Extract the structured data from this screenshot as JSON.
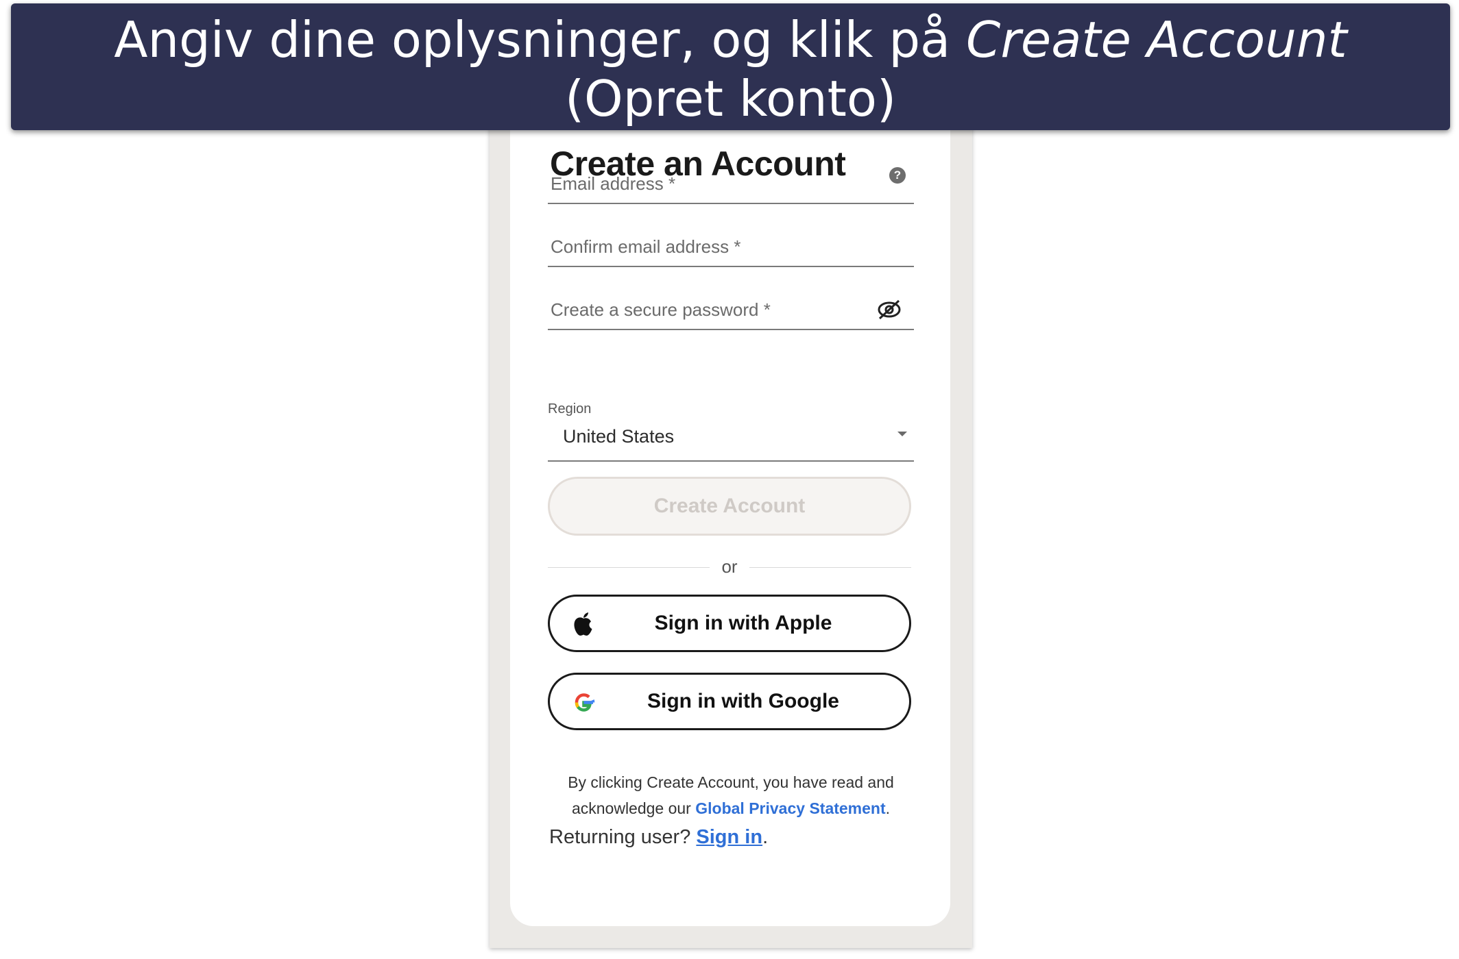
{
  "caption": {
    "part1": "Angiv dine oplysninger, og klik på ",
    "emphasis": "Create Account",
    "part2": " (Opret konto)"
  },
  "form": {
    "title": "Create an Account",
    "email_placeholder": "Email address *",
    "confirm_email_placeholder": "Confirm email address *",
    "password_placeholder": "Create a secure password *",
    "region_label": "Region",
    "region_value": "United States",
    "create_button": "Create Account",
    "divider_text": "or",
    "apple_button": "Sign in with Apple",
    "google_button": "Sign in with Google",
    "legal_text": "By clicking Create Account, you have read and acknowledge our ",
    "privacy_link": "Global Privacy Statement",
    "legal_end": ".",
    "returning_text": "Returning user? ",
    "signin_link": "Sign in",
    "returning_end": "."
  },
  "icons": {
    "help": "help-icon",
    "eye": "eye-off-icon",
    "apple": "apple-icon",
    "google": "google-icon",
    "caret": "chevron-down-icon"
  },
  "colors": {
    "banner": "#2e3152",
    "link": "#2f6fd6",
    "disabled_button_text": "#cfcac6"
  }
}
